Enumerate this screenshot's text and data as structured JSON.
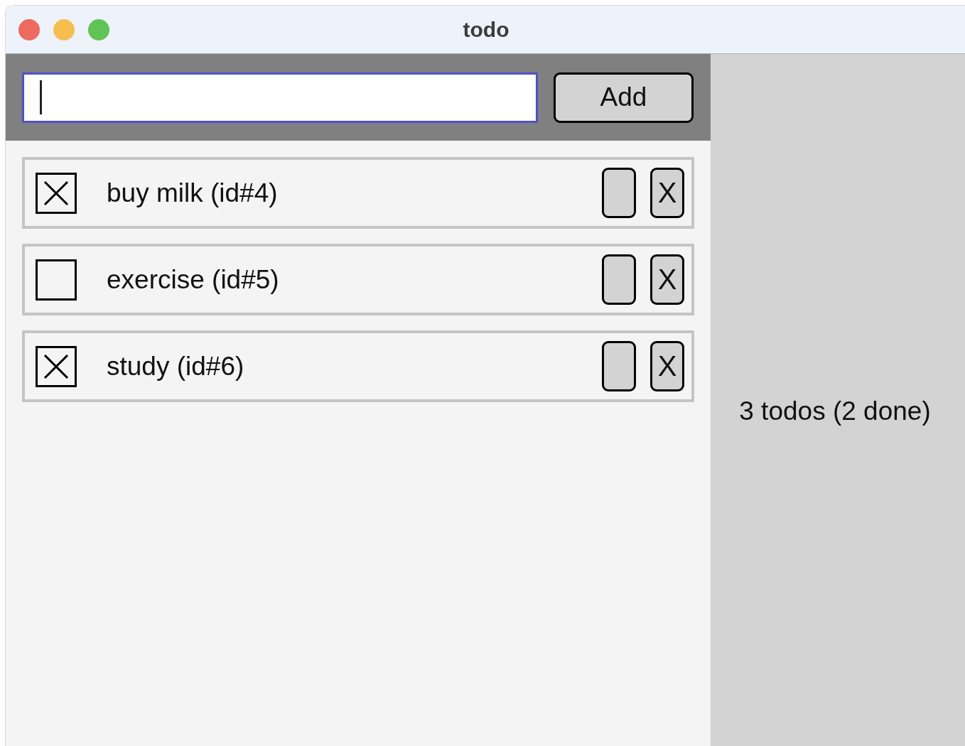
{
  "window": {
    "title": "todo"
  },
  "new_todo": {
    "add_button": "Add"
  },
  "todos": [
    {
      "label": "buy milk (id#4)",
      "done": true,
      "delete_button": "X"
    },
    {
      "label": "exercise (id#5)",
      "done": false,
      "delete_button": "X"
    },
    {
      "label": "study (id#6)",
      "done": true,
      "delete_button": "X"
    }
  ],
  "summary": "3 todos (2 done)"
}
